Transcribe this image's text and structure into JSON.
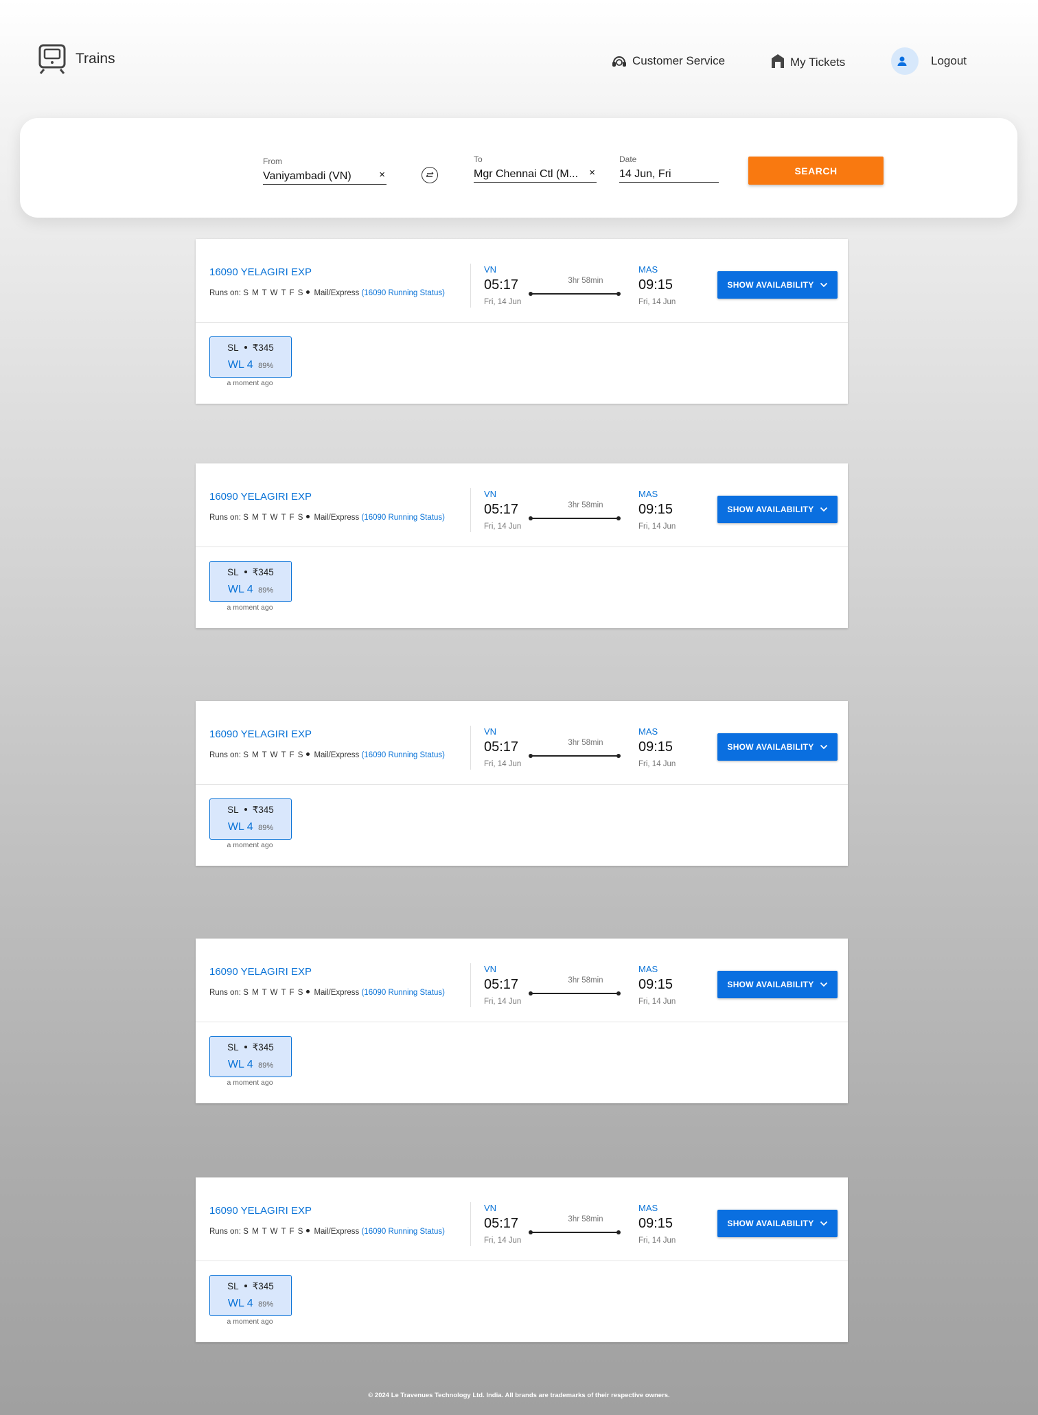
{
  "header": {
    "brand": "Trains",
    "nav": {
      "customer_service": "Customer Service",
      "my_tickets": "My Tickets",
      "logout": "Logout"
    }
  },
  "search": {
    "from_label": "From",
    "from_value": "Vaniyambadi (VN)",
    "to_label": "To",
    "to_value": "Mgr Chennai Ctl (M...",
    "date_label": "Date",
    "date_value": "14 Jun, Fri",
    "clear_symbol": "×",
    "search_button": "SEARCH"
  },
  "colors": {
    "accent_blue": "#0a6fe0",
    "link_blue": "#0a73d7",
    "search_orange": "#f97910",
    "class_box_bg": "#d9e7fc"
  },
  "trains": [
    {
      "name": "16090 YELAGIRI EXP",
      "runs_label": "Runs on:",
      "days": "S M T W T F S",
      "type": "Mail/Express",
      "running_status": "(16090 Running Status)",
      "from_code": "VN",
      "dep_time": "05:17",
      "dep_date": "Fri, 14 Jun",
      "duration": "3hr 58min",
      "to_code": "MAS",
      "arr_time": "09:15",
      "arr_date": "Fri, 14 Jun",
      "button": "SHOW AVAILABILITY",
      "class": "SL",
      "fare": "₹345",
      "status": "WL 4",
      "probability": "89%",
      "updated": "a moment ago"
    },
    {
      "name": "16090 YELAGIRI EXP",
      "runs_label": "Runs on:",
      "days": "S M T W T F S",
      "type": "Mail/Express",
      "running_status": "(16090 Running Status)",
      "from_code": "VN",
      "dep_time": "05:17",
      "dep_date": "Fri, 14 Jun",
      "duration": "3hr 58min",
      "to_code": "MAS",
      "arr_time": "09:15",
      "arr_date": "Fri, 14 Jun",
      "button": "SHOW AVAILABILITY",
      "class": "SL",
      "fare": "₹345",
      "status": "WL 4",
      "probability": "89%",
      "updated": "a moment ago"
    },
    {
      "name": "16090 YELAGIRI EXP",
      "runs_label": "Runs on:",
      "days": "S M T W T F S",
      "type": "Mail/Express",
      "running_status": "(16090 Running Status)",
      "from_code": "VN",
      "dep_time": "05:17",
      "dep_date": "Fri, 14 Jun",
      "duration": "3hr 58min",
      "to_code": "MAS",
      "arr_time": "09:15",
      "arr_date": "Fri, 14 Jun",
      "button": "SHOW AVAILABILITY",
      "class": "SL",
      "fare": "₹345",
      "status": "WL 4",
      "probability": "89%",
      "updated": "a moment ago"
    },
    {
      "name": "16090 YELAGIRI EXP",
      "runs_label": "Runs on:",
      "days": "S M T W T F S",
      "type": "Mail/Express",
      "running_status": "(16090 Running Status)",
      "from_code": "VN",
      "dep_time": "05:17",
      "dep_date": "Fri, 14 Jun",
      "duration": "3hr 58min",
      "to_code": "MAS",
      "arr_time": "09:15",
      "arr_date": "Fri, 14 Jun",
      "button": "SHOW AVAILABILITY",
      "class": "SL",
      "fare": "₹345",
      "status": "WL 4",
      "probability": "89%",
      "updated": "a moment ago"
    },
    {
      "name": "16090 YELAGIRI EXP",
      "runs_label": "Runs on:",
      "days": "S M T W T F S",
      "type": "Mail/Express",
      "running_status": "(16090 Running Status)",
      "from_code": "VN",
      "dep_time": "05:17",
      "dep_date": "Fri, 14 Jun",
      "duration": "3hr 58min",
      "to_code": "MAS",
      "arr_time": "09:15",
      "arr_date": "Fri, 14 Jun",
      "button": "SHOW AVAILABILITY",
      "class": "SL",
      "fare": "₹345",
      "status": "WL 4",
      "probability": "89%",
      "updated": "a moment ago"
    }
  ],
  "footer": "© 2024 Le Travenues Technology Ltd. India. All brands are trademarks of their respective owners."
}
